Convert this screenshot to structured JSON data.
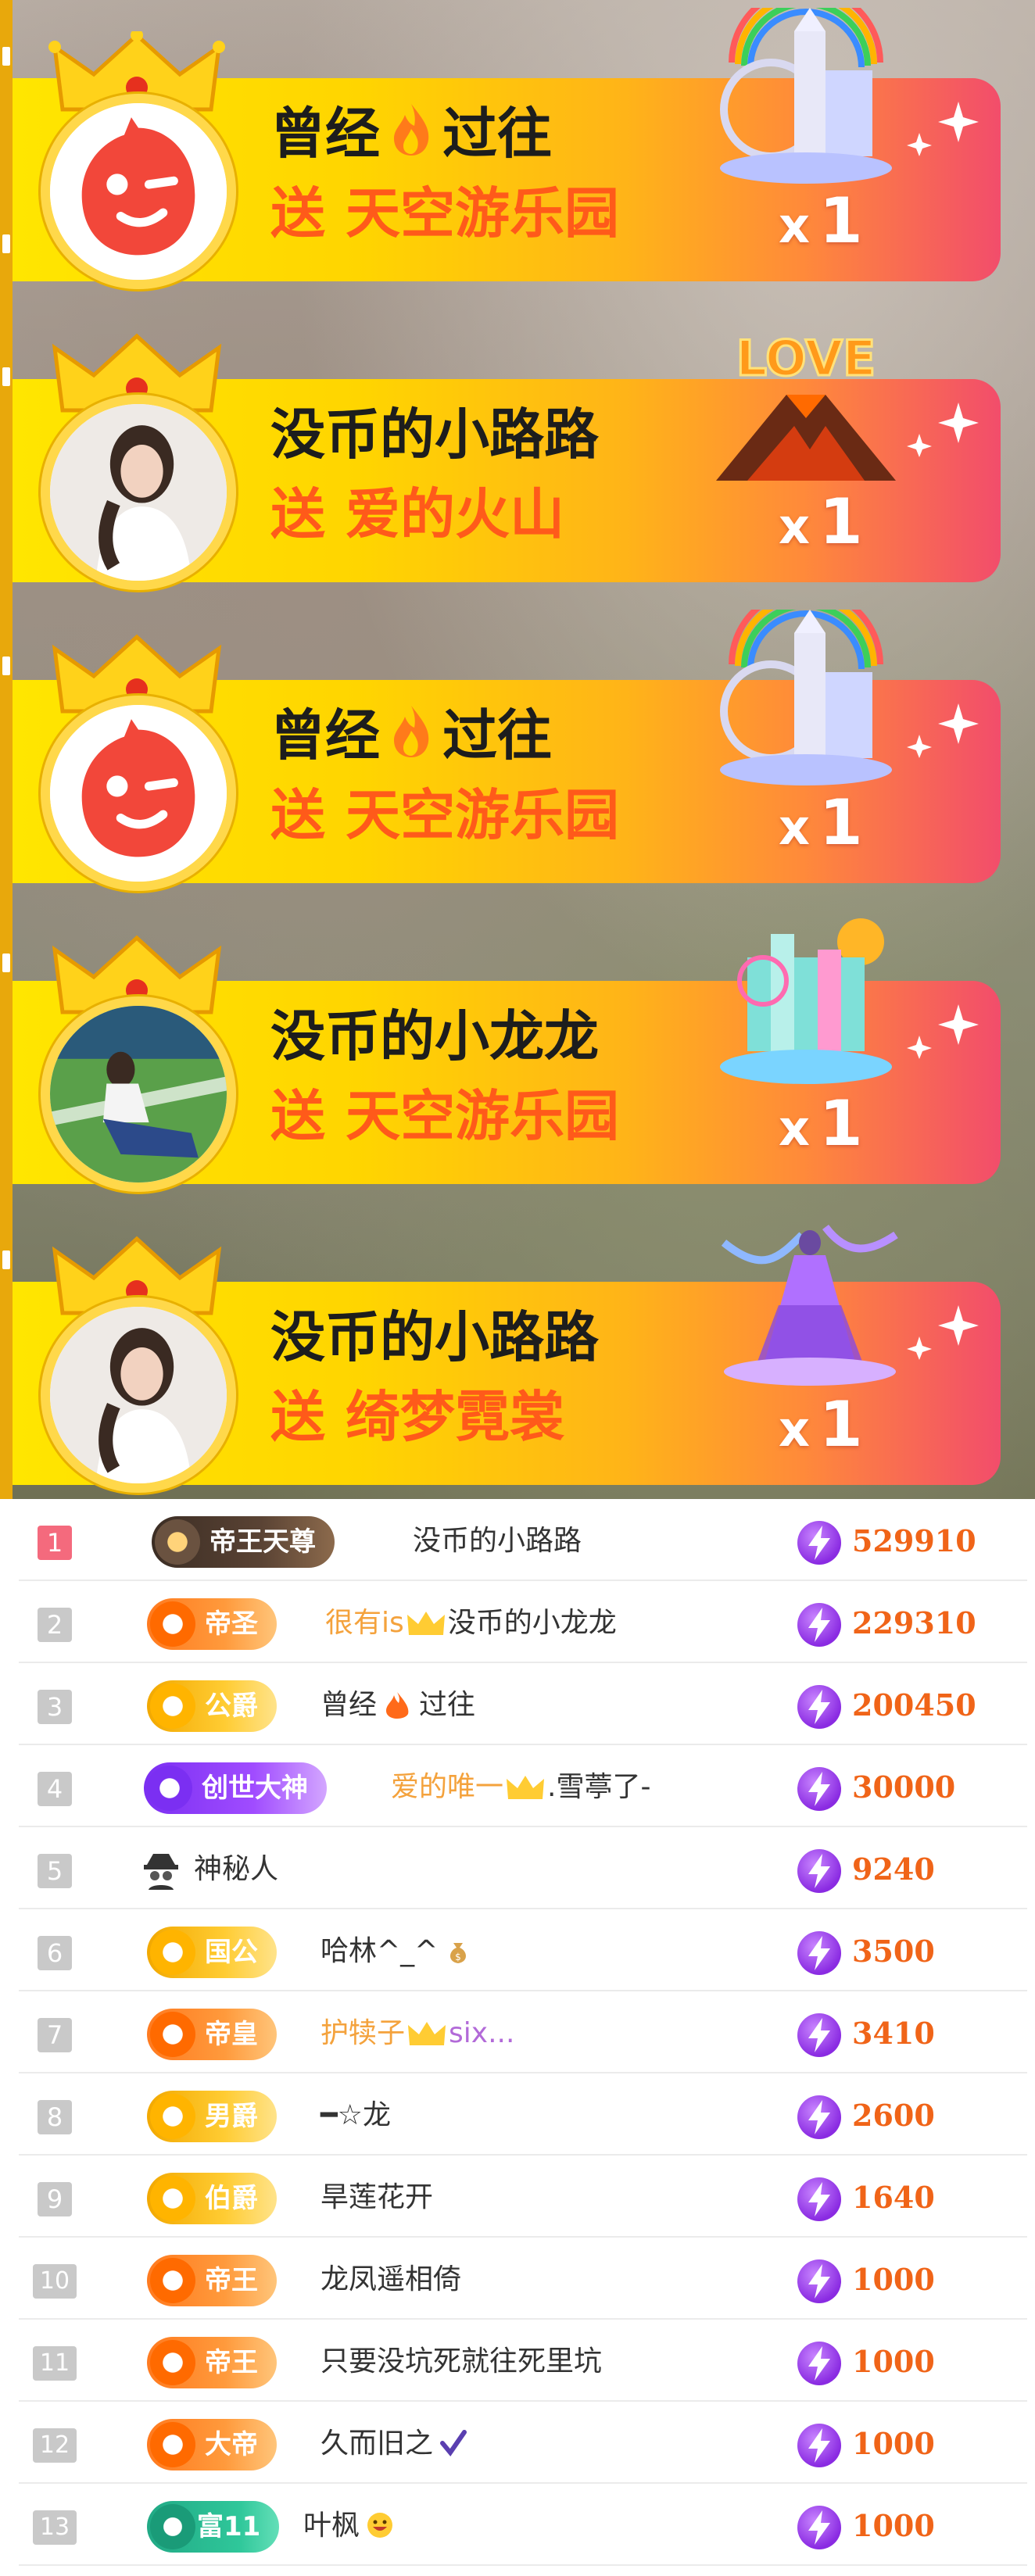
{
  "gift_banners": [
    {
      "sender": "曾经",
      "sender_suffix": "过往",
      "has_fire": true,
      "send_word": "送",
      "gift_name": "天空游乐园",
      "count_x": "x",
      "count": "1",
      "avatar": "red-smiley-avatar",
      "gift_icon": "sky-amusement-park-icon"
    },
    {
      "sender": "没币的小路路",
      "sender_suffix": "",
      "has_fire": false,
      "send_word": "送",
      "gift_name": "爱的火山",
      "count_x": "x",
      "count": "1",
      "avatar": "girl-photo-avatar",
      "gift_icon": "love-volcano-icon"
    },
    {
      "sender": "曾经",
      "sender_suffix": "过往",
      "has_fire": true,
      "send_word": "送",
      "gift_name": "天空游乐园",
      "count_x": "x",
      "count": "1",
      "avatar": "red-smiley-avatar",
      "gift_icon": "sky-amusement-park-icon"
    },
    {
      "sender": "没币的小龙龙",
      "sender_suffix": "",
      "has_fire": false,
      "send_word": "送",
      "gift_name": "天空游乐园",
      "count_x": "x",
      "count": "1",
      "avatar": "girl-sitting-avatar",
      "gift_icon": "sky-amusement-park-icon"
    },
    {
      "sender": "没币的小路路",
      "sender_suffix": "",
      "has_fire": false,
      "send_word": "送",
      "gift_name": "绮梦霓裳",
      "count_x": "x",
      "count": "1",
      "avatar": "girl-photo-avatar",
      "gift_icon": "dream-dress-icon"
    }
  ],
  "ranking": [
    {
      "rank": "1",
      "badge": "帝王天尊",
      "badge_style": "dark",
      "name": "没币的小路路",
      "fan_prefix": "",
      "fan_suffix": "",
      "score": "529910"
    },
    {
      "rank": "2",
      "badge": "帝圣",
      "badge_style": "orange",
      "name": "没币的小龙龙",
      "fan_prefix": "很有is",
      "fan_suffix": "",
      "score": "229310"
    },
    {
      "rank": "3",
      "badge": "公爵",
      "badge_style": "gold",
      "name": "曾经",
      "name_suffix": "过往",
      "fan_prefix": "",
      "fan_suffix": "",
      "score": "200450"
    },
    {
      "rank": "4",
      "badge": "创世大神",
      "badge_style": "purple",
      "name": ".雪葶了-",
      "fan_prefix": "爱的唯一",
      "fan_suffix": "",
      "score": "30000"
    },
    {
      "rank": "5",
      "badge": "",
      "badge_style": "none",
      "name": "神秘人",
      "fan_prefix": "",
      "fan_suffix": "",
      "score": "9240"
    },
    {
      "rank": "6",
      "badge": "国公",
      "badge_style": "gold",
      "name": "哈林^_^",
      "fan_prefix": "",
      "fan_suffix": "",
      "score": "3500"
    },
    {
      "rank": "7",
      "badge": "帝皇",
      "badge_style": "orange",
      "name": "six...",
      "fan_prefix": "护犊子",
      "fan_suffix": "",
      "score": "3410"
    },
    {
      "rank": "8",
      "badge": "男爵",
      "badge_style": "gold",
      "name": "━☆龙",
      "fan_prefix": "",
      "fan_suffix": "",
      "score": "2600"
    },
    {
      "rank": "9",
      "badge": "伯爵",
      "badge_style": "gold",
      "name": "旱莲花开",
      "fan_prefix": "",
      "fan_suffix": "",
      "score": "1640"
    },
    {
      "rank": "10",
      "badge": "帝王",
      "badge_style": "orange",
      "name": "龙凤遥相倚",
      "fan_prefix": "",
      "fan_suffix": "",
      "score": "1000"
    },
    {
      "rank": "11",
      "badge": "帝王",
      "badge_style": "orange",
      "name": "只要没坑死就往死里坑",
      "fan_prefix": "",
      "fan_suffix": "",
      "score": "1000"
    },
    {
      "rank": "12",
      "badge": "大帝",
      "badge_style": "orange",
      "name": "久而旧之",
      "fan_prefix": "",
      "fan_suffix": "",
      "score": "1000"
    },
    {
      "rank": "13",
      "badge": "富11",
      "badge_style": "green",
      "name": "叶枫",
      "fan_prefix": "",
      "fan_suffix": "",
      "score": "1000"
    }
  ],
  "colors": {
    "accent_orange": "#ff5a1a",
    "score_orange": "#f06418",
    "rank1_pink": "#f46a7d",
    "banner_yellow": "#ffe600",
    "banner_pink": "#f24d6b"
  }
}
